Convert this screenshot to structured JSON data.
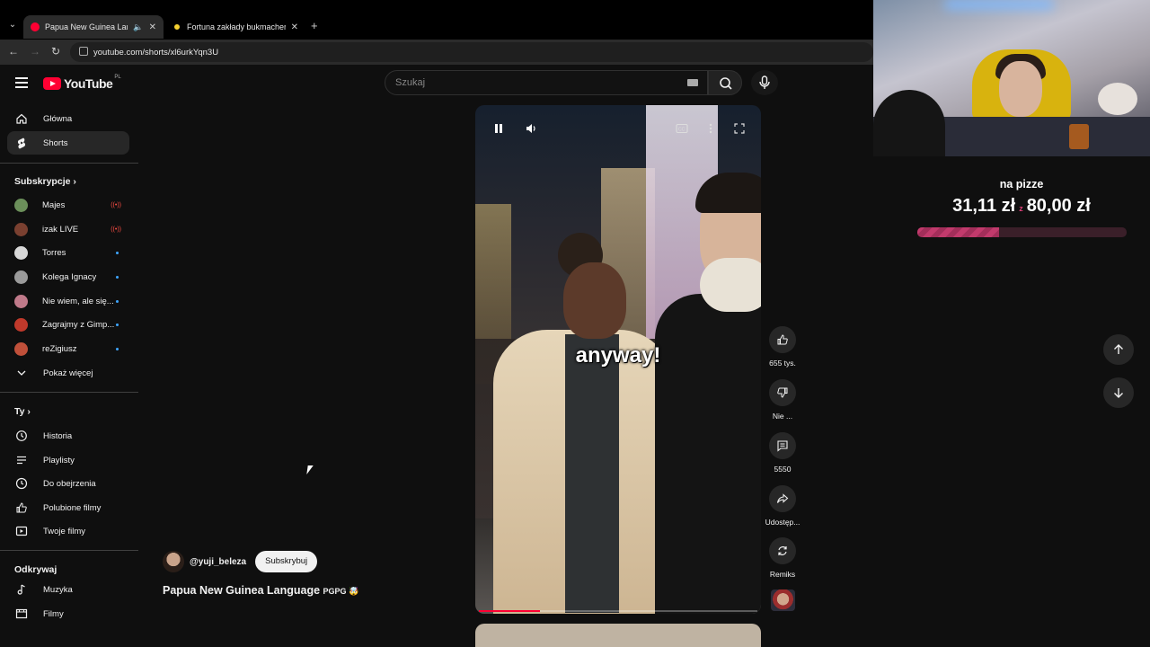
{
  "browser": {
    "tabs": [
      {
        "title": "Papua New Guinea Langua",
        "favicon_color": "#ff0033",
        "active": true,
        "audio": true
      },
      {
        "title": "Fortuna zakłady bukmacherskie",
        "favicon_color": "#f5d130",
        "active": false,
        "audio": false
      }
    ],
    "url": "youtube.com/shorts/xl6urkYqn3U"
  },
  "header": {
    "logo_text": "YouTube",
    "country": "PL",
    "search_placeholder": "Szukaj"
  },
  "sidebar": {
    "main": [
      {
        "label": "Główna",
        "icon": "home-icon"
      },
      {
        "label": "Shorts",
        "icon": "shorts-icon",
        "active": true
      }
    ],
    "subs_title": "Subskrypcje",
    "subscriptions": [
      {
        "label": "Majes",
        "indicator": "live",
        "color": "#6b8f5a"
      },
      {
        "label": "izak LIVE",
        "indicator": "live",
        "color": "#7a4030"
      },
      {
        "label": "Torres",
        "indicator": "dot",
        "color": "#d8d8d8"
      },
      {
        "label": "Kolega Ignacy",
        "indicator": "dot",
        "color": "#9a9a9a"
      },
      {
        "label": "Nie wiem, ale się...",
        "indicator": "dot",
        "color": "#c07a8a"
      },
      {
        "label": "Zagrajmy z Gimp...",
        "indicator": "dot",
        "color": "#c0392b"
      },
      {
        "label": "reZigiusz",
        "indicator": "dot",
        "color": "#c0503a"
      }
    ],
    "show_more": "Pokaż więcej",
    "you_title": "Ty",
    "you_items": [
      {
        "label": "Historia",
        "icon": "history-icon"
      },
      {
        "label": "Playlisty",
        "icon": "playlist-icon"
      },
      {
        "label": "Do obejrzenia",
        "icon": "clock-icon"
      },
      {
        "label": "Polubione filmy",
        "icon": "thumbs-up-icon"
      },
      {
        "label": "Twoje filmy",
        "icon": "video-icon"
      }
    ],
    "explore_title": "Odkrywaj",
    "explore_items": [
      {
        "label": "Muzyka",
        "icon": "music-icon"
      },
      {
        "label": "Filmy",
        "icon": "film-icon"
      }
    ]
  },
  "short": {
    "caption": "anyway!",
    "progress": 0.22,
    "channel_handle": "@yuji_beleza",
    "subscribe_label": "Subskrybuj",
    "title": "Papua New Guinea Language",
    "title_tag": "PGPG 🤯"
  },
  "actions": {
    "likes": "655 tys.",
    "dislike": "Nie ...",
    "comments": "5550",
    "share": "Udostęp...",
    "remix": "Remiks"
  },
  "stream_overlay": {
    "goal_label": "na pizze",
    "current": "31,11 zł",
    "separator": "z",
    "target": "80,00 zł",
    "progress": 0.39,
    "accent": "#c23a6c"
  }
}
